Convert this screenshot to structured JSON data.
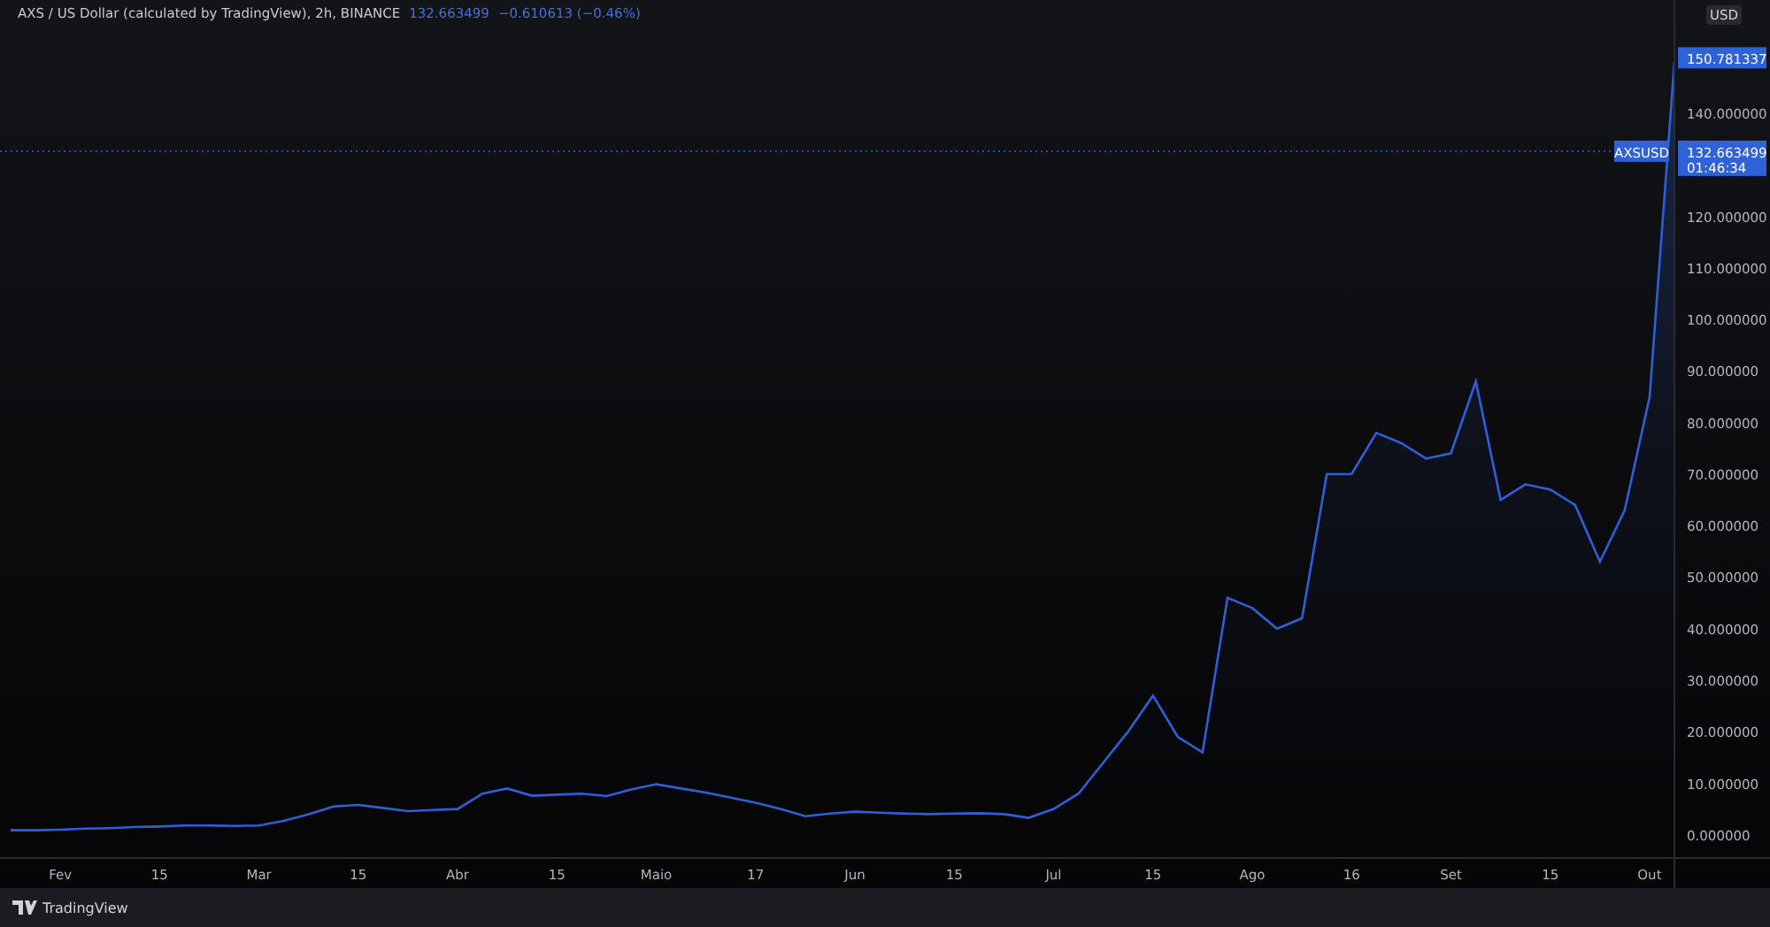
{
  "header": {
    "title": "AXS / US Dollar (calculated by TradingView), 2h, BINANCE",
    "last": "132.663499",
    "change": "−0.610613 (−0.46%)"
  },
  "currency_button": "USD",
  "chart_data": {
    "type": "area",
    "ylim": [
      -4.5,
      162
    ],
    "ref_lines": [
      {
        "axis": "y",
        "value": 132.66
      }
    ],
    "categories": [
      null,
      null,
      "Fev",
      null,
      null,
      null,
      "15",
      null,
      null,
      null,
      "Mar",
      null,
      null,
      null,
      "15",
      null,
      null,
      null,
      "Abr",
      null,
      null,
      null,
      "15",
      null,
      null,
      null,
      "Maio",
      null,
      null,
      null,
      "17",
      null,
      null,
      null,
      "Jun",
      null,
      null,
      null,
      "15",
      null,
      null,
      null,
      "Jul",
      null,
      null,
      null,
      "15",
      null,
      null,
      null,
      "Ago",
      null,
      null,
      null,
      "16",
      null,
      null,
      null,
      "Set",
      null,
      null,
      null,
      "15",
      null,
      null,
      null,
      "Out",
      null
    ],
    "yticks": [
      {
        "value": 0,
        "label": "0.000000"
      },
      {
        "value": 10,
        "label": "10.000000"
      },
      {
        "value": 20,
        "label": "20.000000"
      },
      {
        "value": 30,
        "label": "30.000000"
      },
      {
        "value": 40,
        "label": "40.000000"
      },
      {
        "value": 50,
        "label": "50.000000"
      },
      {
        "value": 60,
        "label": "60.000000"
      },
      {
        "value": 70,
        "label": "70.000000"
      },
      {
        "value": 80,
        "label": "80.000000"
      },
      {
        "value": 90,
        "label": "90.000000"
      },
      {
        "value": 100,
        "label": "100.000000"
      },
      {
        "value": 110,
        "label": "110.000000"
      },
      {
        "value": 120,
        "label": "120.000000"
      },
      {
        "value": 140,
        "label": "140.000000"
      }
    ],
    "series": [
      {
        "color": "#2f5fd8",
        "values": [
          0.9,
          0.9,
          1.0,
          1.2,
          1.3,
          1.5,
          1.6,
          1.8,
          1.8,
          1.7,
          1.8,
          2.7,
          4,
          5.5,
          5.8,
          5.2,
          4.6,
          4.8,
          5,
          8,
          9,
          7.6,
          7.8,
          8,
          7.5,
          8.8,
          9.8,
          9,
          8.2,
          7.2,
          6.2,
          5,
          3.6,
          4.1,
          4.5,
          4.3,
          4.1,
          4,
          4.1,
          4.2,
          4,
          3.3,
          5,
          8,
          14,
          20,
          27,
          19,
          16,
          46,
          44,
          40,
          42,
          70,
          70,
          78,
          76,
          73,
          74,
          88,
          65,
          68,
          67,
          64,
          53,
          63,
          85,
          150
        ]
      }
    ]
  },
  "high_badge": {
    "price": "150.781337"
  },
  "last_badge": {
    "symbol": "AXSUSD",
    "price": "132.663499",
    "countdown": "01:46:34"
  },
  "brand": "TradingView"
}
